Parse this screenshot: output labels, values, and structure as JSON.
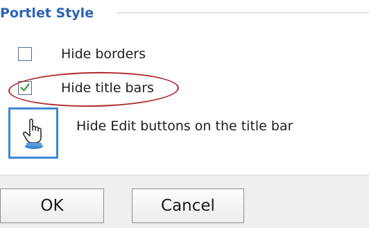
{
  "portlet_style": {
    "title": "Portlet Style",
    "options": [
      {
        "label": "Hide borders",
        "checked": false
      },
      {
        "label": "Hide title bars",
        "checked": true
      }
    ],
    "edit_buttons_label": "Hide Edit buttons on the title bar",
    "edit_buttons_icon": "hand-pointer-icon"
  },
  "annotation": {
    "highlight_color": "#b02a2a",
    "highlighted_option": "Hide title bars"
  },
  "footer": {
    "ok_label": "OK",
    "cancel_label": "Cancel"
  },
  "colors": {
    "title": "#2b63b5",
    "checkmark": "#2e9a3a",
    "icon_frame": "#3f86d3"
  }
}
